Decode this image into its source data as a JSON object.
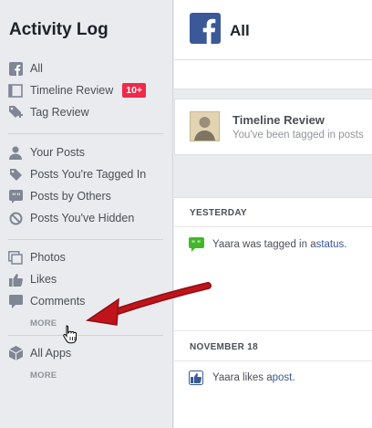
{
  "sidebar": {
    "title": "Activity Log",
    "items": [
      {
        "label": "All",
        "icon": "facebook-icon"
      },
      {
        "label": "Timeline Review",
        "icon": "timeline-icon",
        "badge": "10+"
      },
      {
        "label": "Tag Review",
        "icon": "tag-plus-icon"
      },
      {
        "label": "Your Posts",
        "icon": "person-icon"
      },
      {
        "label": "Posts You're Tagged In",
        "icon": "tag-icon"
      },
      {
        "label": "Posts by Others",
        "icon": "quote-icon"
      },
      {
        "label": "Posts You've Hidden",
        "icon": "hidden-icon"
      },
      {
        "label": "Photos",
        "icon": "photos-icon"
      },
      {
        "label": "Likes",
        "icon": "like-icon"
      },
      {
        "label": "Comments",
        "icon": "comment-icon"
      },
      {
        "label": "All Apps",
        "icon": "apps-cube-icon"
      }
    ],
    "more_1": "MORE",
    "more_2": "MORE"
  },
  "main": {
    "header_title": "All",
    "review_card": {
      "title": "Timeline Review",
      "subtitle": "You've been tagged in posts"
    },
    "sections": [
      {
        "header": "YESTERDAY",
        "entry": {
          "prefix": "Yaara was tagged in a ",
          "link": "status",
          "suffix": "."
        }
      },
      {
        "header": "NOVEMBER 18",
        "entry": {
          "prefix": "Yaara likes a ",
          "link": "post",
          "suffix": "."
        }
      }
    ]
  },
  "colors": {
    "facebook_blue": "#3b5998",
    "link_blue": "#365899",
    "badge_red": "#f02849",
    "arrow_red": "#c0141b",
    "tag_green": "#42b72a"
  }
}
